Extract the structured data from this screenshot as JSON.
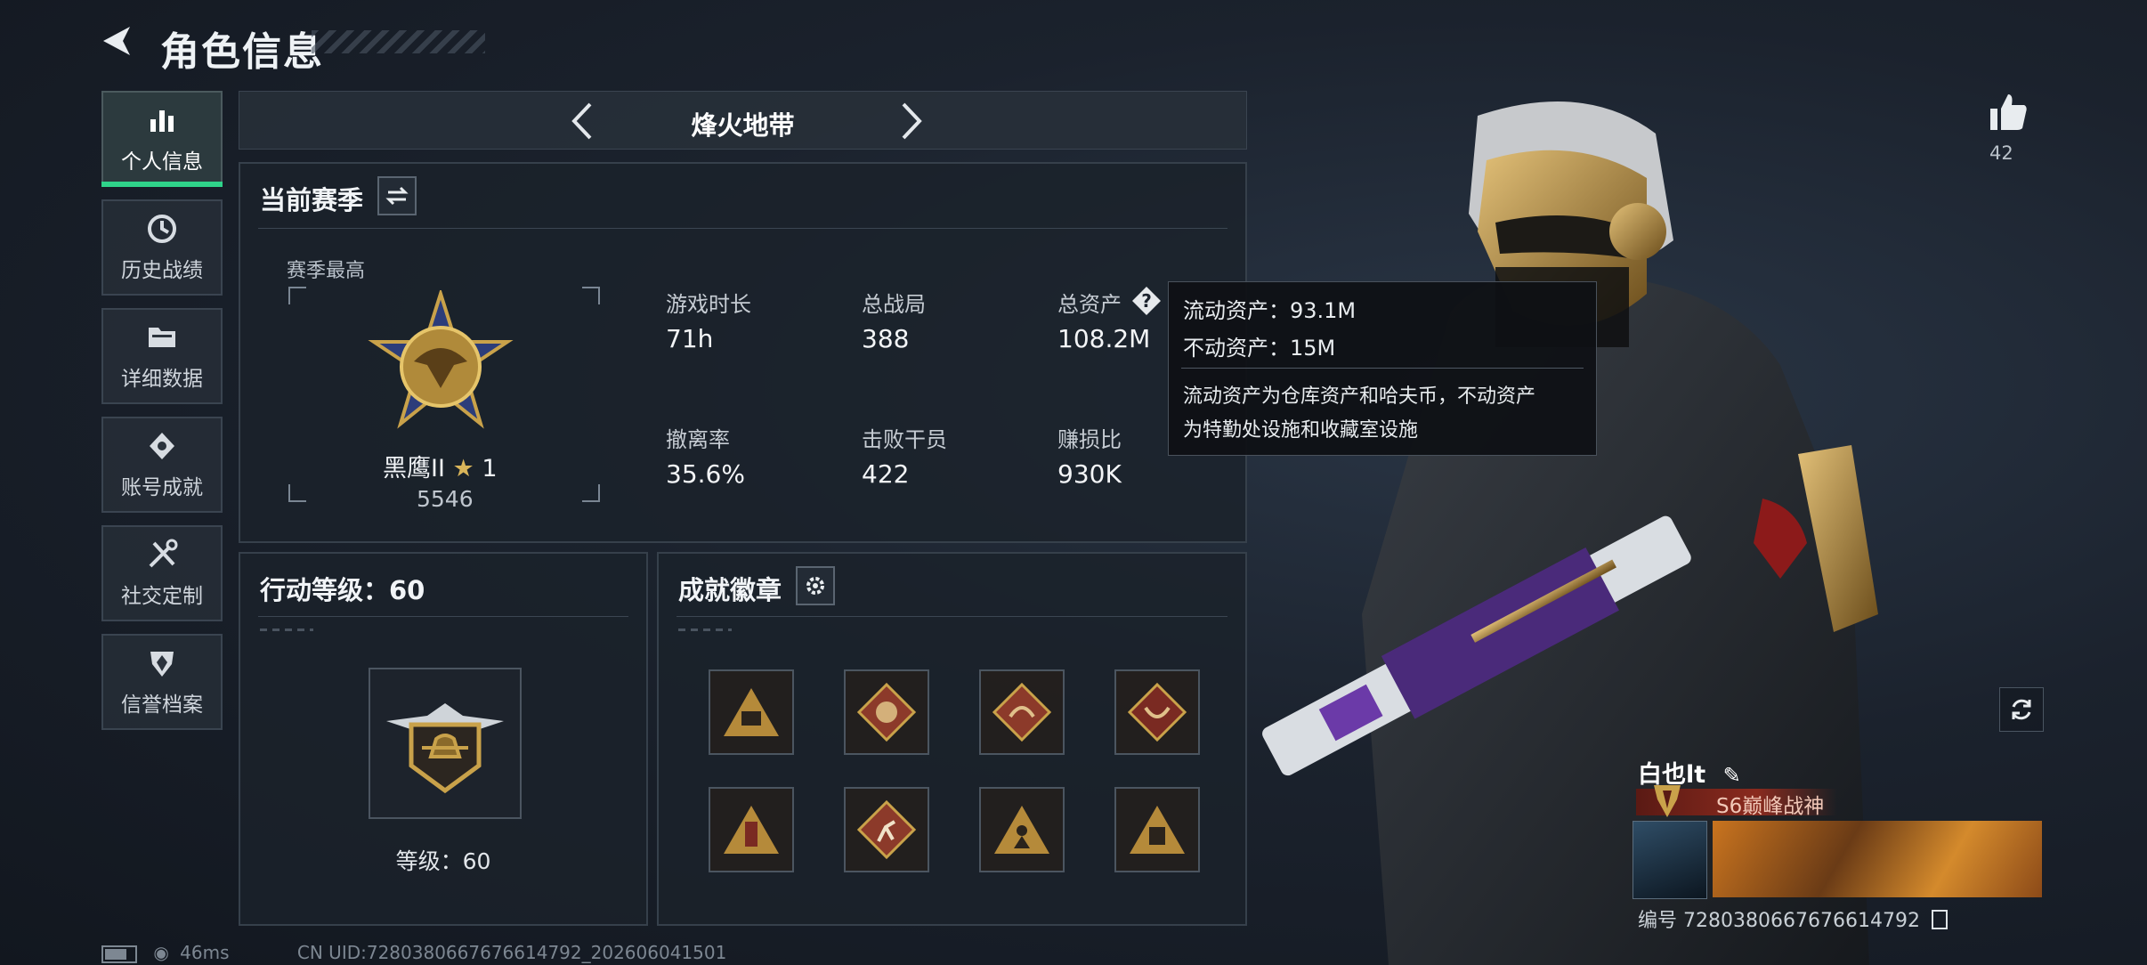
{
  "header": {
    "title": "角色信息"
  },
  "sidebar": {
    "items": [
      {
        "label": "个人信息",
        "icon": "bar-chart-icon",
        "active": true
      },
      {
        "label": "历史战绩",
        "icon": "history-clock-icon",
        "active": false
      },
      {
        "label": "详细数据",
        "icon": "folder-icon",
        "active": false
      },
      {
        "label": "账号成就",
        "icon": "achievement-icon",
        "active": false
      },
      {
        "label": "社交定制",
        "icon": "tools-icon",
        "active": false
      },
      {
        "label": "信誉档案",
        "icon": "shield-icon",
        "active": false
      }
    ]
  },
  "mode_selector": {
    "label": "烽火地带"
  },
  "season_panel": {
    "title": "当前赛季",
    "best_label": "赛季最高",
    "rank_name": "黑鹰II",
    "rank_stars": "1",
    "rank_score": "5546",
    "stats": [
      {
        "label": "游戏时长",
        "value": "71h"
      },
      {
        "label": "总战局",
        "value": "388"
      },
      {
        "label": "总资产",
        "value": "108.2M"
      },
      {
        "label": "撤离率",
        "value": "35.6%"
      },
      {
        "label": "击败干员",
        "value": "422"
      },
      {
        "label": "赚损比",
        "value": "930K"
      }
    ]
  },
  "tooltip": {
    "liquid": "流动资产：93.1M",
    "fixed": "不动资产：15M",
    "desc_line1": "流动资产为仓库资产和哈夫币，不动资产",
    "desc_line2": "为特勤处设施和收藏室设施"
  },
  "level_panel": {
    "title": "行动等级：60",
    "level_text": "等级：60"
  },
  "badges_panel": {
    "title": "成就徽章",
    "badges": [
      "badge-58-icon",
      "badge-wolf-icon",
      "badge-dragon-icon",
      "badge-dragon-red-icon",
      "badge-tower-icon",
      "badge-runner-icon",
      "badge-figure-icon",
      "badge-crate-icon"
    ]
  },
  "likes": {
    "count": "42"
  },
  "player": {
    "name": "白也lt",
    "rank_title": "S6巅峰战神",
    "id": "编号 7280380667676614792"
  },
  "status": {
    "latency": "46ms",
    "uid": "CN UID:7280380667676614792_202606041501"
  },
  "colors": {
    "accent_green": "#2fd38a",
    "gold": "#c9a24a"
  }
}
